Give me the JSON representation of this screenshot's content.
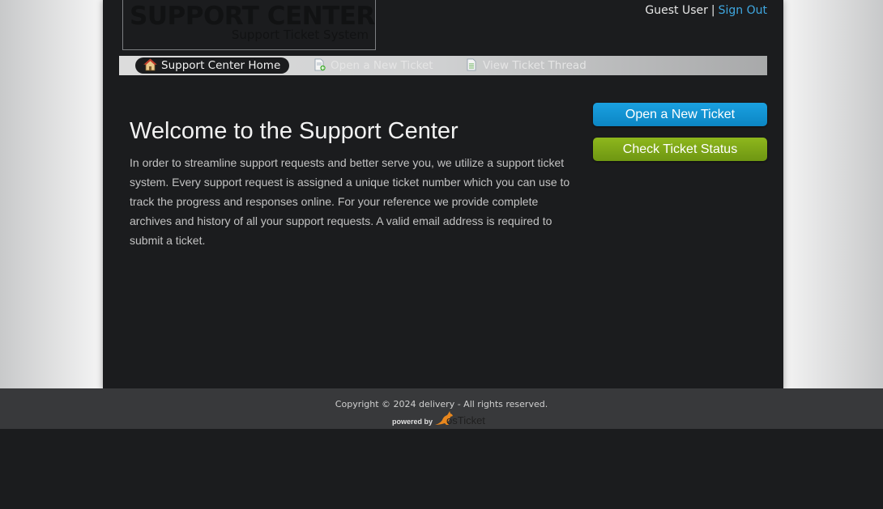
{
  "header": {
    "logo_title": "SUPPORT CENTER",
    "logo_subtitle": "Support Ticket System",
    "user_name": "Guest User",
    "separator": "|",
    "sign_out": "Sign Out"
  },
  "nav": {
    "items": [
      {
        "label": "Support Center Home",
        "icon": "home-icon",
        "active": true
      },
      {
        "label": "Open a New Ticket",
        "icon": "new-ticket-icon",
        "active": false
      },
      {
        "label": "View Ticket Thread",
        "icon": "ticket-thread-icon",
        "active": false
      }
    ]
  },
  "main": {
    "title": "Welcome to the Support Center",
    "intro": "In order to streamline support requests and better serve you, we utilize a support ticket system. Every support request is assigned a unique ticket number which you can use to track the progress and responses online. For your reference we provide complete archives and history of all your support requests. A valid email address is required to submit a ticket."
  },
  "sidebar": {
    "open_ticket_label": "Open a New Ticket",
    "check_status_label": "Check Ticket Status"
  },
  "footer": {
    "copyright": "Copyright © 2024 delivery - All rights reserved.",
    "powered_by": "powered by",
    "brand": "osTicket"
  },
  "colors": {
    "link": "#3fa7e0",
    "blue_button": "#0c86c4",
    "green_button": "#6e9612",
    "background": "#1b1c1e",
    "footer": "#38393b"
  }
}
